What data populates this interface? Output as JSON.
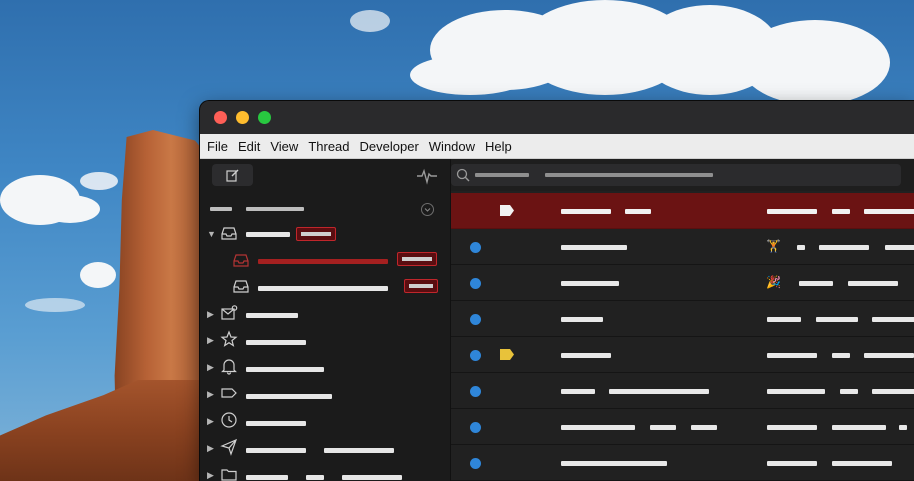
{
  "menu": {
    "file": "File",
    "edit": "Edit",
    "view": "View",
    "thread": "Thread",
    "developer": "Developer",
    "window": "Window",
    "help": "Help"
  },
  "icons": {
    "compose": "compose-icon",
    "activity": "activity-icon",
    "search": "search-icon",
    "inbox": "inbox-icon",
    "unread": "unread-mail-icon",
    "star": "star-icon",
    "bell": "bell-icon",
    "label": "label-icon",
    "clock": "clock-icon",
    "sent": "send-icon",
    "folder": "folder-icon"
  },
  "colors": {
    "selection": "#6b1313",
    "unread_dot": "#2f86d9",
    "tag_yellow": "#e8c23a",
    "badge_border": "#c0262b",
    "close": "#fe5f57",
    "minimize": "#febc2e",
    "maximize": "#28c840"
  },
  "messages": [
    {
      "selected": true,
      "unread": false,
      "tag": "white",
      "emoji": ""
    },
    {
      "selected": false,
      "unread": true,
      "tag": "",
      "emoji": "🏋"
    },
    {
      "selected": false,
      "unread": true,
      "tag": "",
      "emoji": "🎉"
    },
    {
      "selected": false,
      "unread": true,
      "tag": "",
      "emoji": ""
    },
    {
      "selected": false,
      "unread": true,
      "tag": "yellow",
      "emoji": ""
    },
    {
      "selected": false,
      "unread": true,
      "tag": "",
      "emoji": ""
    },
    {
      "selected": false,
      "unread": true,
      "tag": "",
      "emoji": ""
    },
    {
      "selected": false,
      "unread": true,
      "tag": "",
      "emoji": ""
    }
  ]
}
